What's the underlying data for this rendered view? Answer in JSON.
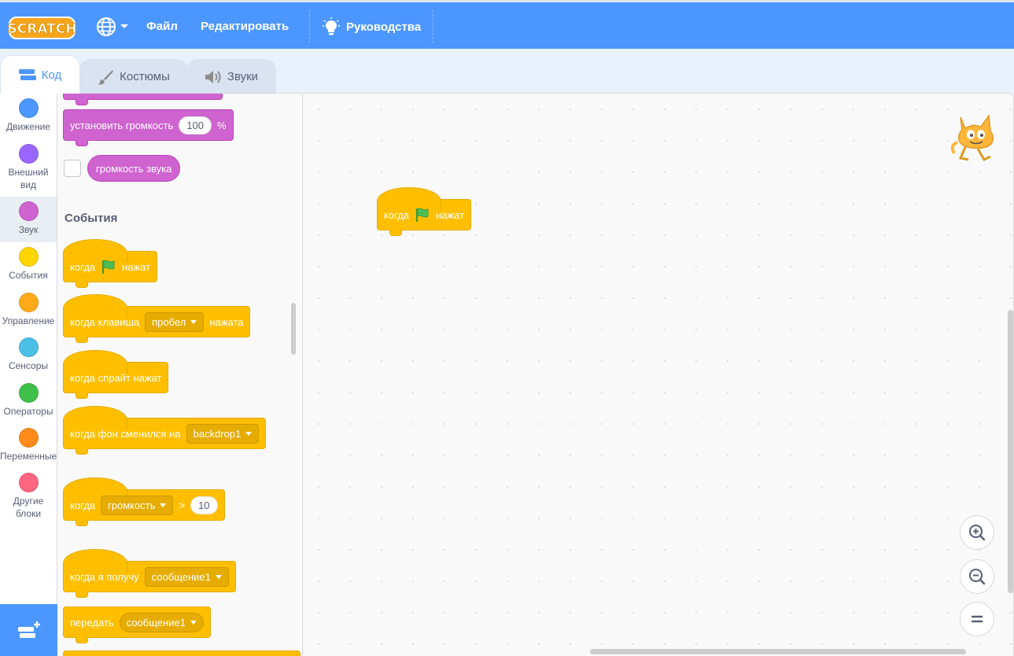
{
  "menu": {
    "file": "Файл",
    "edit": "Редактировать",
    "tutorials": "Руководства"
  },
  "tabs": {
    "code": "Код",
    "costumes": "Костюмы",
    "sounds": "Звуки"
  },
  "categories": [
    {
      "label": "Движение",
      "color": "#4c97ff"
    },
    {
      "label": "Внешний вид",
      "color": "#9966ff"
    },
    {
      "label": "Звук",
      "color": "#cf63cf"
    },
    {
      "label": "События",
      "color": "#ffd500"
    },
    {
      "label": "Управление",
      "color": "#ffab19"
    },
    {
      "label": "Сенсоры",
      "color": "#4cbfe6"
    },
    {
      "label": "Операторы",
      "color": "#40bf4a"
    },
    {
      "label": "Переменные",
      "color": "#ff8c1a"
    },
    {
      "label": "Другие блоки",
      "color": "#ff6680"
    }
  ],
  "palette": {
    "set_volume": {
      "text": "установить громкость",
      "value": "100",
      "suffix": "%"
    },
    "volume_reporter": "громкость звука",
    "events_title": "События",
    "when_flag": {
      "pre": "когда",
      "post": "нажат"
    },
    "when_key": {
      "pre": "когда клавиша",
      "key": "пробел",
      "post": "нажата"
    },
    "when_sprite_clicked": "когда спрайт нажат",
    "when_backdrop": {
      "pre": "когда фон сменился на",
      "value": "backdrop1"
    },
    "when_greater": {
      "pre": "когда",
      "param": "громкость",
      "op": ">",
      "value": "10"
    },
    "when_receive": {
      "pre": "когда я получу",
      "message": "сообщение1"
    },
    "broadcast": {
      "pre": "передать",
      "message": "сообщение1"
    }
  },
  "workspace": {
    "script_block": {
      "pre": "когда",
      "post": "нажат"
    }
  },
  "colors": {
    "menu_blue": "#4c97ff",
    "events_yellow": "#ffbf00",
    "sound_pink": "#cf63cf",
    "flag_green": "#4cbf56"
  },
  "icons": {
    "logo": "scratch-logo",
    "globe": "globe-icon",
    "tutorials": "lightbulb-icon",
    "code_tab": "code-blocks-icon",
    "costumes_tab": "paintbrush-icon",
    "sounds_tab": "speaker-icon",
    "flag": "green-flag-icon",
    "extension": "add-extension-icon",
    "zoom_in": "zoom-in-icon",
    "zoom_out": "zoom-out-icon",
    "zoom_reset": "zoom-reset-icon",
    "sprite": "sprite-cat-icon"
  }
}
